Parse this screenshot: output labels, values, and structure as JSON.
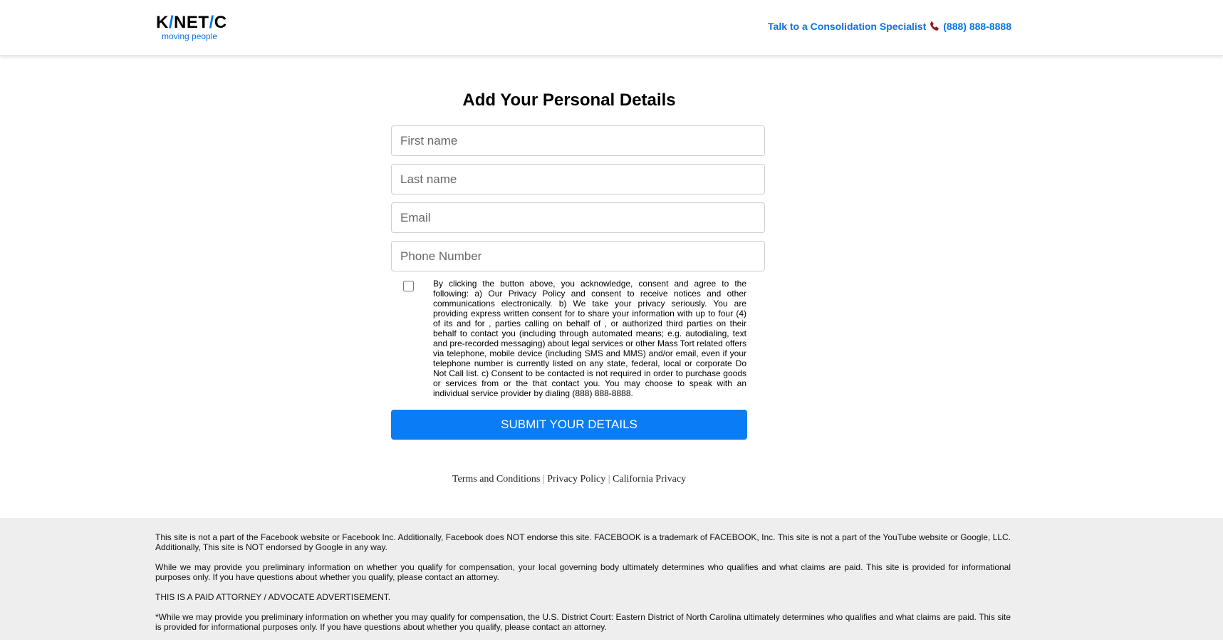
{
  "header": {
    "logo_text_parts": [
      "K",
      "/",
      "NET",
      "/",
      "C"
    ],
    "logo_tagline": "moving people",
    "contact_label": "Talk to a Consolidation Specialist",
    "contact_phone": "(888) 888-8888"
  },
  "form": {
    "title": "Add Your Personal Details",
    "first_name_placeholder": "First name",
    "last_name_placeholder": "Last name",
    "email_placeholder": "Email",
    "phone_placeholder": "Phone Number",
    "consent_checked": false,
    "consent_text": "By clicking the button above, you acknowledge, consent and agree to the following: a) Our Privacy Policy and consent to receive notices and other communications electronically. b) We take your privacy seriously. You are providing express written consent for to share your information with up to four (4) of its and for , parties calling on behalf of , or authorized third parties on their behalf to contact you (including through automated means; e.g. autodialing, text and pre-recorded messaging) about legal services or other Mass Tort related offers via telephone, mobile device (including SMS and MMS) and/or email, even if your telephone number is currently listed on any state, federal, local or corporate Do Not Call list. c) Consent to be contacted is not required in order to purchase goods or services from or the that contact you. You may choose to speak with an individual service provider by dialing (888) 888-8888.",
    "submit_label": "SUBMIT YOUR DETAILS"
  },
  "links": {
    "terms": "Terms and Conditions",
    "privacy": "Privacy Policy",
    "california": "California Privacy",
    "separator": "|"
  },
  "footer": {
    "p1": "This site is not a part of the Facebook website or Facebook Inc. Additionally, Facebook does NOT endorse this site. FACEBOOK is a trademark of FACEBOOK, Inc. This site is not a part of the YouTube website or Google, LLC. Additionally, This site is NOT endorsed by Google in any way.",
    "p2": "While we may provide you preliminary information on whether you qualify for compensation, your local governing body ultimately determines who qualifies and what claims are paid. This site is provided for informational purposes only. If you have questions about whether you qualify, please contact an attorney.",
    "p3": "THIS IS A PAID ATTORNEY / ADVOCATE ADVERTISEMENT.",
    "p4": "*While we may provide you preliminary information on whether you may qualify for compensation, the U.S. District Court: Eastern District of North Carolina ultimately determines who qualifies and what claims are paid. This site is provided for informational purposes only. If you have questions about whether you qualify, please contact an attorney."
  },
  "colors": {
    "brand_blue": "#0a74e6",
    "button_blue": "#0a7cf5",
    "footer_bg": "#eeeeee"
  },
  "icons": {
    "phone": "phone-icon"
  }
}
